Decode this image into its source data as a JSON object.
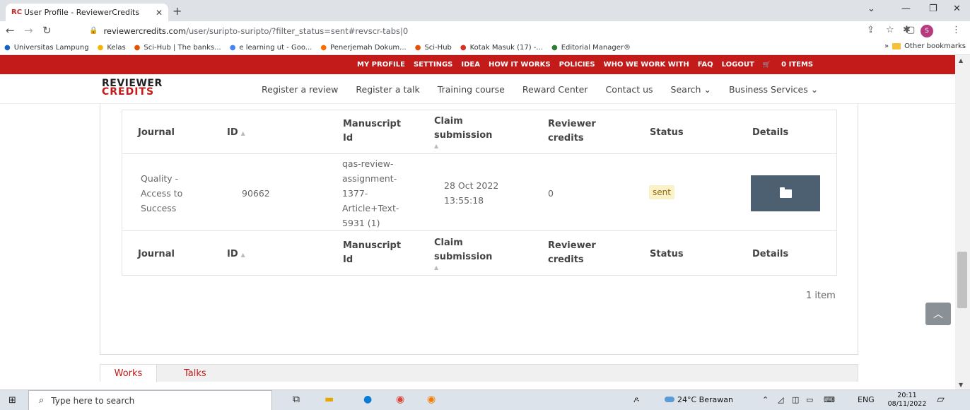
{
  "browser": {
    "tab_title": "User Profile - ReviewerCredits",
    "tab_favicon": "RC",
    "url_host": "reviewercredits.com",
    "url_path": "/user/suripto-suripto/?filter_status=sent#revscr-tabs|0",
    "profile_initial": "S",
    "bookmarks": [
      {
        "label": "Universitas Lampung",
        "icon": "university-icon",
        "color": "#1565c0"
      },
      {
        "label": "Kelas",
        "icon": "classroom-icon",
        "color": "#f4b400"
      },
      {
        "label": "Sci-Hub | The banks...",
        "icon": "scihub-icon",
        "color": "#e65100"
      },
      {
        "label": "e learning ut - Goo...",
        "icon": "google-icon",
        "color": "#4285f4"
      },
      {
        "label": "Penerjemah Dokum...",
        "icon": "translate-icon",
        "color": "#ff6d00"
      },
      {
        "label": "Sci-Hub",
        "icon": "scihub-icon",
        "color": "#e65100"
      },
      {
        "label": "Kotak Masuk (17) -...",
        "icon": "gmail-icon",
        "color": "#d93025"
      },
      {
        "label": "Editorial Manager®",
        "icon": "editorial-icon",
        "color": "#2e7d32"
      }
    ],
    "other_bookmarks": "Other bookmarks",
    "overflow": "»"
  },
  "topnav": [
    "MY PROFILE",
    "SETTINGS",
    "IDEA",
    "HOW IT WORKS",
    "POLICIES",
    "WHO WE WORK WITH",
    "FAQ",
    "LOGOUT",
    "0 ITEMS"
  ],
  "logo": {
    "line1": "REVIEWER",
    "line2": "CREDITS"
  },
  "mainnav": [
    "Register a review",
    "Register a talk",
    "Training course",
    "Reward Center",
    "Contact us",
    "Search ⌄",
    "Business Services ⌄"
  ],
  "table": {
    "headers": {
      "journal": "Journal",
      "id": "ID",
      "manuscript_1": "Manuscript",
      "manuscript_2": "Id",
      "claim_1": "Claim",
      "claim_2": "submission",
      "credits_1": "Reviewer",
      "credits_2": "credits",
      "status": "Status",
      "details": "Details"
    },
    "row": {
      "journal": [
        "Quality -",
        "Access to",
        "Success"
      ],
      "id": "90662",
      "manuscript": [
        "qas-review-",
        "assignment-",
        "1377-",
        "Article+Text-",
        "5931 (1)"
      ],
      "claim_date": "28 Oct 2022",
      "claim_time": "13:55:18",
      "credits": "0",
      "status": "sent"
    }
  },
  "item_count": "1 item",
  "profile_tabs": [
    "Works",
    "Talks"
  ],
  "taskbar": {
    "search_placeholder": "Type here to search",
    "weather": "24°C  Berawan",
    "lang": "ENG",
    "time": "20:11",
    "date": "08/11/2022"
  },
  "colors": {
    "brand_red": "#c31a1a",
    "details_button": "#4c6072",
    "status_badge_bg": "#fcf2c8"
  }
}
